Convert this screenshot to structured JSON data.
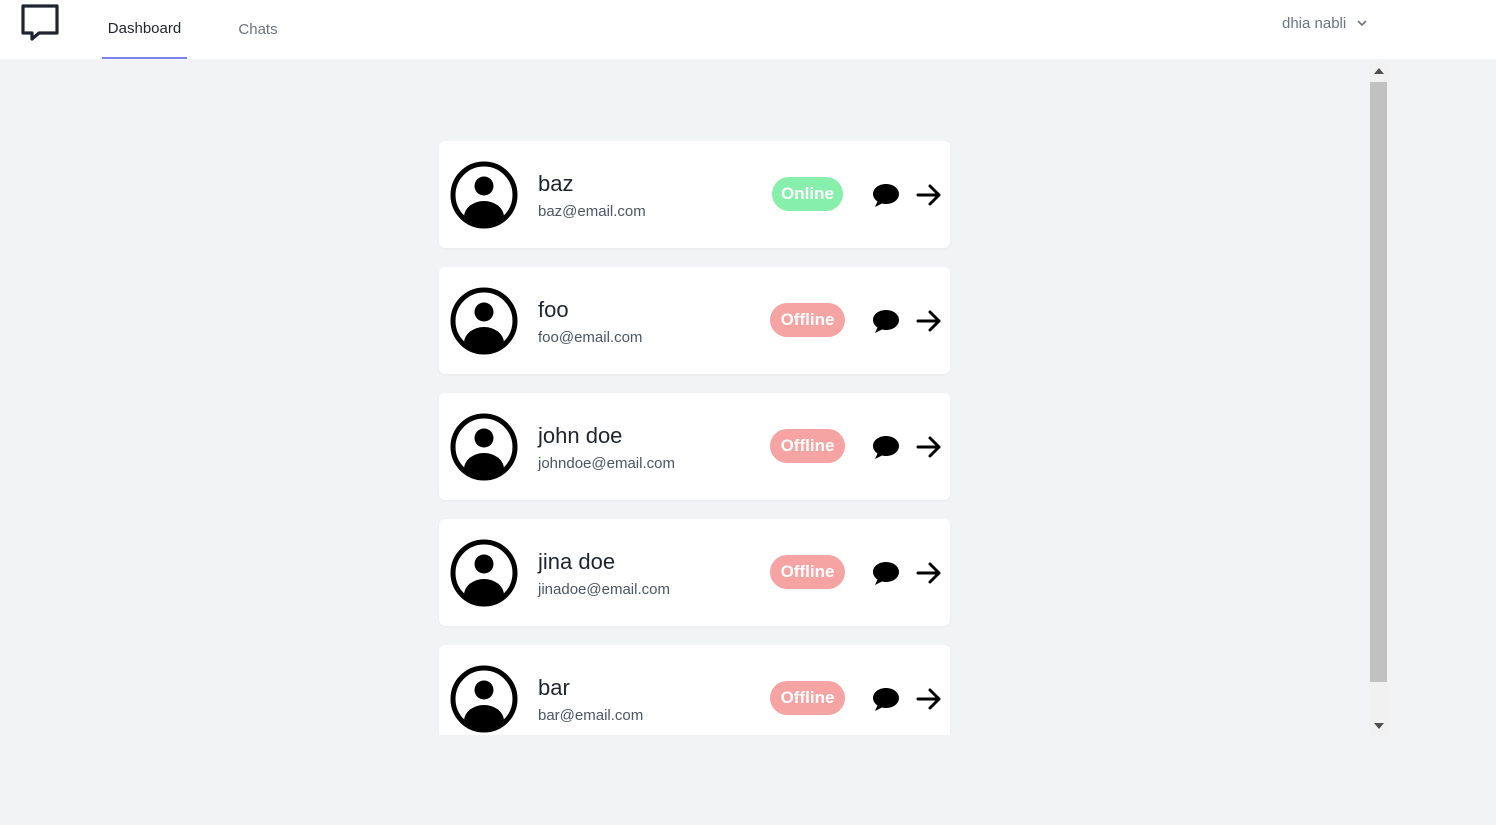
{
  "app": {
    "logo_icon": "chat-bubble-outline-icon"
  },
  "nav": {
    "tabs": [
      {
        "label": "Dashboard",
        "active": true
      },
      {
        "label": "Chats",
        "active": false
      }
    ]
  },
  "user_menu": {
    "name": "dhia nabli",
    "icon": "chevron-down-icon"
  },
  "users": [
    {
      "name": "baz",
      "email": "baz@email.com",
      "status": "Online"
    },
    {
      "name": "foo",
      "email": "foo@email.com",
      "status": "Offline"
    },
    {
      "name": "john doe",
      "email": "johndoe@email.com",
      "status": "Offline"
    },
    {
      "name": "jina doe",
      "email": "jinadoe@email.com",
      "status": "Offline"
    },
    {
      "name": "bar",
      "email": "bar@email.com",
      "status": "Offline"
    }
  ],
  "colors": {
    "online": "#86efac",
    "offline": "#f5a3a3",
    "accent": "#7c83f0",
    "background": "#f2f3f5"
  },
  "icons": {
    "avatar": "user-circle-icon",
    "chat": "speech-bubble-icon",
    "open": "arrow-right-icon"
  }
}
